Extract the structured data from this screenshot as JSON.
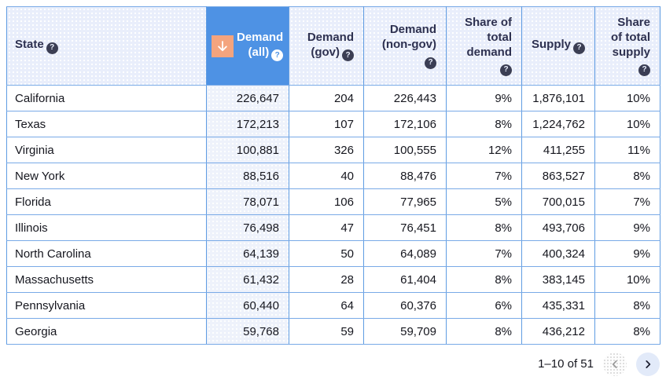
{
  "table": {
    "columns": [
      {
        "label": "State"
      },
      {
        "label": "Demand (all)"
      },
      {
        "label": "Demand (gov)"
      },
      {
        "label": "Demand (non-gov)"
      },
      {
        "label": "Share of total demand"
      },
      {
        "label": "Supply"
      },
      {
        "label": "Share of total supply"
      }
    ],
    "sort": {
      "column": "Demand (all)",
      "direction": "descending"
    },
    "rows": [
      {
        "state": "California",
        "demand_all": "226,647",
        "demand_gov": "204",
        "demand_nongov": "226,443",
        "share_demand": "9%",
        "supply": "1,876,101",
        "share_supply": "10%"
      },
      {
        "state": "Texas",
        "demand_all": "172,213",
        "demand_gov": "107",
        "demand_nongov": "172,106",
        "share_demand": "8%",
        "supply": "1,224,762",
        "share_supply": "10%"
      },
      {
        "state": "Virginia",
        "demand_all": "100,881",
        "demand_gov": "326",
        "demand_nongov": "100,555",
        "share_demand": "12%",
        "supply": "411,255",
        "share_supply": "11%"
      },
      {
        "state": "New York",
        "demand_all": "88,516",
        "demand_gov": "40",
        "demand_nongov": "88,476",
        "share_demand": "7%",
        "supply": "863,527",
        "share_supply": "8%"
      },
      {
        "state": "Florida",
        "demand_all": "78,071",
        "demand_gov": "106",
        "demand_nongov": "77,965",
        "share_demand": "5%",
        "supply": "700,015",
        "share_supply": "7%"
      },
      {
        "state": "Illinois",
        "demand_all": "76,498",
        "demand_gov": "47",
        "demand_nongov": "76,451",
        "share_demand": "8%",
        "supply": "493,706",
        "share_supply": "9%"
      },
      {
        "state": "North Carolina",
        "demand_all": "64,139",
        "demand_gov": "50",
        "demand_nongov": "64,089",
        "share_demand": "7%",
        "supply": "400,324",
        "share_supply": "9%"
      },
      {
        "state": "Massachusetts",
        "demand_all": "61,432",
        "demand_gov": "28",
        "demand_nongov": "61,404",
        "share_demand": "8%",
        "supply": "383,145",
        "share_supply": "10%"
      },
      {
        "state": "Pennsylvania",
        "demand_all": "60,440",
        "demand_gov": "64",
        "demand_nongov": "60,376",
        "share_demand": "6%",
        "supply": "435,331",
        "share_supply": "8%"
      },
      {
        "state": "Georgia",
        "demand_all": "59,768",
        "demand_gov": "59",
        "demand_nongov": "59,709",
        "share_demand": "8%",
        "supply": "436,212",
        "share_supply": "8%"
      }
    ]
  },
  "icons": {
    "help_glyph": "?"
  },
  "pagination": {
    "range": "1–10 of 51"
  },
  "colors": {
    "accent_blue": "#4e92e4",
    "sort_orange": "#f4a47e",
    "border_blue": "#5f9ce2",
    "header_bg": "#e9eefb",
    "sorted_cell_bg": "#eef2fb",
    "next_button_bg": "#e2eaf9"
  }
}
